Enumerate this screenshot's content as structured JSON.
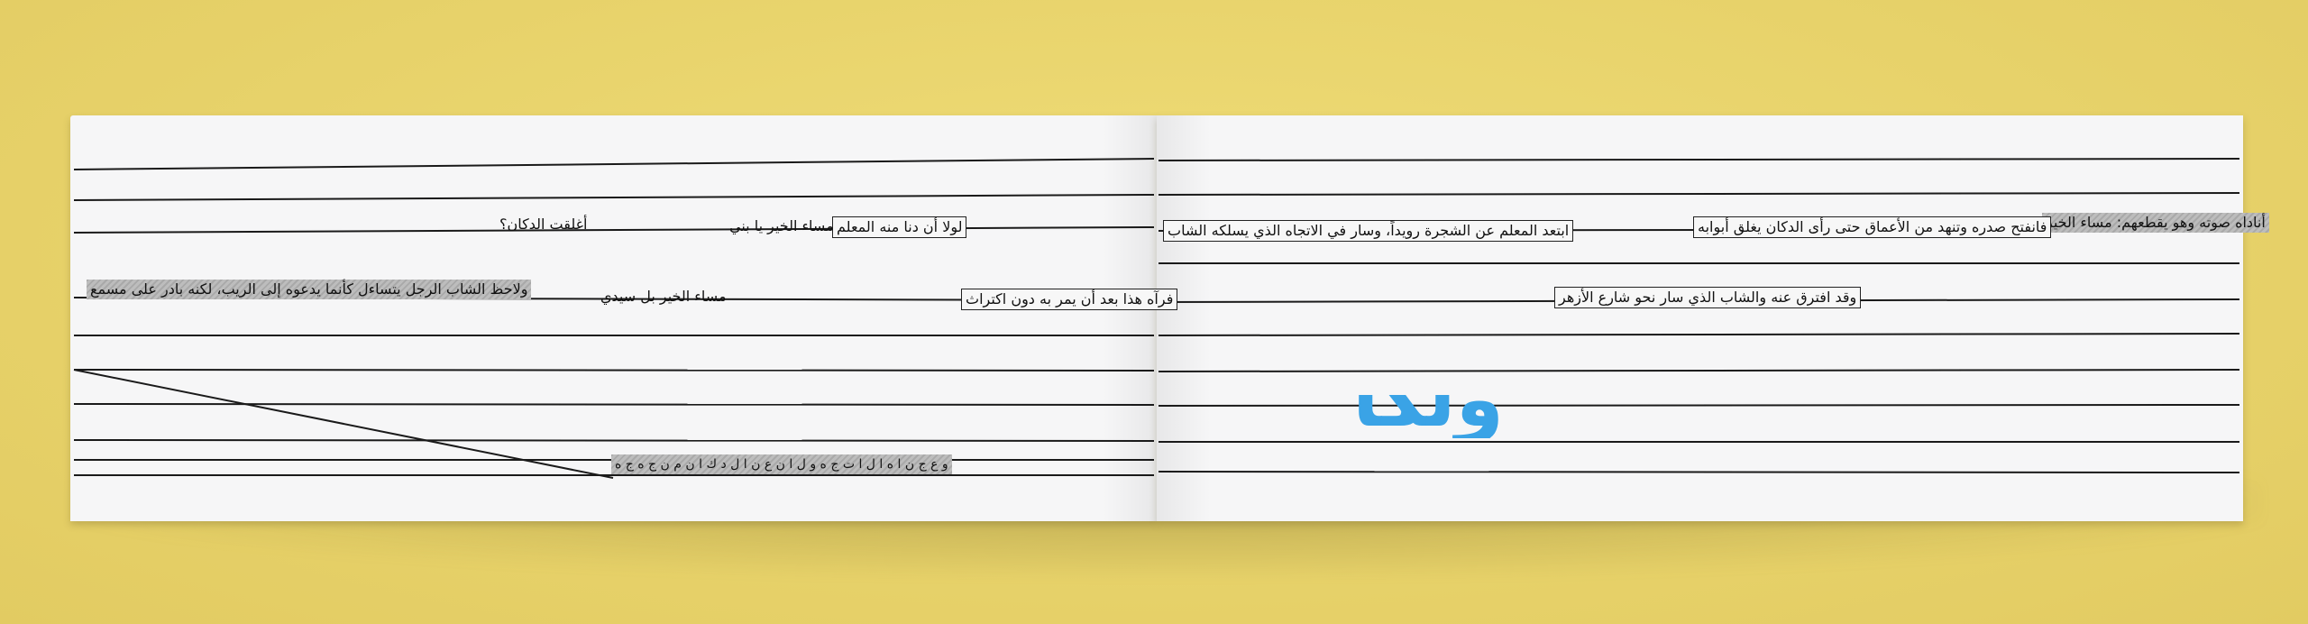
{
  "phrases": {
    "p1": "أناداه صوته وهو يقطعهم: مساء الخير",
    "p2": "فانفتح صدره وتنهد من الأعماق حتى رأى الدكان يغلق أبوابه",
    "p3": "ابتعد المعلم عن الشجرة رويداً، وسار في الاتجاه الذي يسلكه الشاب",
    "p4": "لولا أن دنا منه المعلم",
    "p5": "مساء الخير يا بني",
    "p6": "أغلقت الدكان؟",
    "p7": "وقد افترق عنه والشاب الذي سار نحو شارع الأزهر",
    "p8": "فرآه هذا بعد أن يمر به دون اكتراث",
    "p9": "مساء الخير بل سيدي",
    "p10": "ولاحظ الشاب الرجل يتساءل كأنما يدعوه إلى الريب، لكنه بادر على مسمع",
    "p11": "و ع ج ن ا ه ا ل ا ت ج ه و ل ا ن ع ن ا ل د ك ا ن م ن ج ه ج ه"
  },
  "big_word": "ولكا",
  "colors": {
    "background": "#e9d56d",
    "paper": "#f6f6f7",
    "ink": "#111111",
    "blue": "#3aa3e6"
  }
}
